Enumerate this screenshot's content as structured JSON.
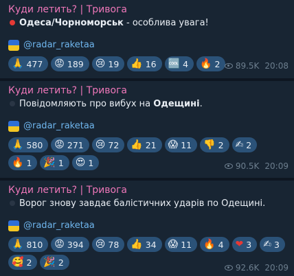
{
  "messages": [
    {
      "author": "Куди летить? | Тривога",
      "text_plain": "",
      "text_bold": "Одеса/Чорноморськ",
      "text_tail": " - особлива увага!",
      "handle": "@radar_raketaa",
      "reactions": [
        {
          "emoji": "🙏",
          "count": "477"
        },
        {
          "emoji": "😡",
          "count": "189"
        },
        {
          "emoji": "😢",
          "count": "19"
        },
        {
          "emoji": "👍",
          "count": "16"
        },
        {
          "emoji": "🆒",
          "count": "4"
        },
        {
          "emoji": "🔥",
          "count": "2"
        }
      ],
      "views": "89.5K",
      "time": "20:08"
    },
    {
      "author": "Куди летить? | Тривога",
      "text_plain": "Повідомляють про вибух на ",
      "text_bold": "Одещині",
      "text_tail": ".",
      "handle": "@radar_raketaa",
      "reactions": [
        {
          "emoji": "🙏",
          "count": "580"
        },
        {
          "emoji": "😡",
          "count": "271"
        },
        {
          "emoji": "😢",
          "count": "72"
        },
        {
          "emoji": "👍",
          "count": "21"
        },
        {
          "emoji": "😱",
          "count": "11"
        },
        {
          "emoji": "👎",
          "count": "2"
        },
        {
          "emoji": "✍",
          "count": "2"
        },
        {
          "emoji": "🔥",
          "count": "1"
        },
        {
          "emoji": "🎉",
          "count": "1"
        },
        {
          "emoji": "😍",
          "count": "1"
        }
      ],
      "views": "90.5K",
      "time": "20:09"
    },
    {
      "author": "Куди летить? | Тривога",
      "text_plain": "Ворог знову завдає балістичних ударів по Одещині.",
      "text_bold": "",
      "text_tail": "",
      "handle": "@radar_raketaa",
      "reactions": [
        {
          "emoji": "🙏",
          "count": "810"
        },
        {
          "emoji": "😡",
          "count": "394"
        },
        {
          "emoji": "😢",
          "count": "78"
        },
        {
          "emoji": "👍",
          "count": "34"
        },
        {
          "emoji": "😱",
          "count": "11"
        },
        {
          "emoji": "🔥",
          "count": "4"
        },
        {
          "emoji": "❤",
          "count": "3"
        },
        {
          "emoji": "✍",
          "count": "3"
        },
        {
          "emoji": "🥰",
          "count": "2"
        },
        {
          "emoji": "🎉",
          "count": "2"
        }
      ],
      "views": "92.6K",
      "time": "20:09"
    }
  ]
}
